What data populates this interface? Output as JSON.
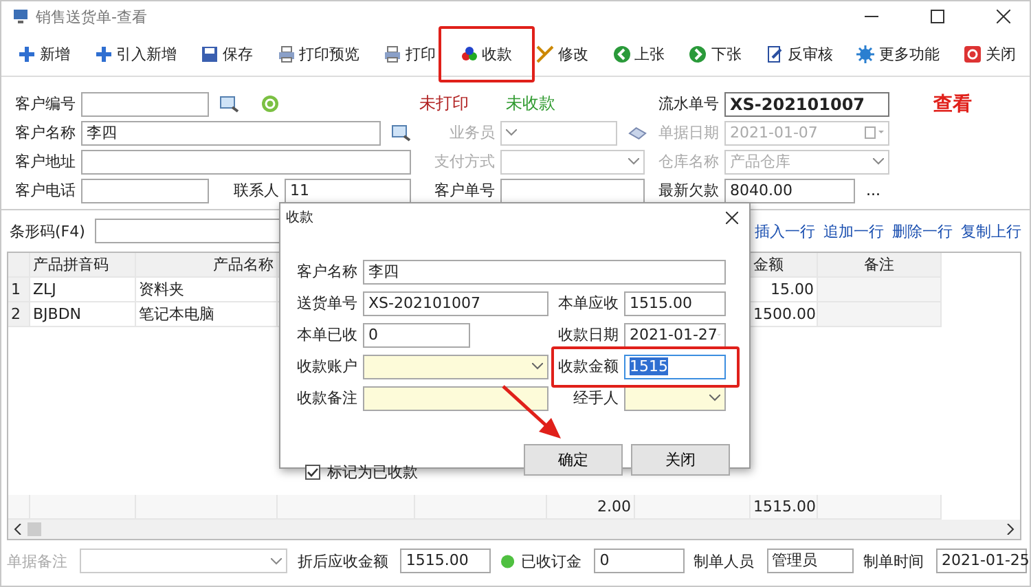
{
  "window": {
    "title": "销售送货单-查看"
  },
  "toolbar": [
    {
      "label": "新增",
      "highlighted": false
    },
    {
      "label": "引入新增",
      "highlighted": false
    },
    {
      "label": "保存",
      "highlighted": false
    },
    {
      "label": "打印预览",
      "highlighted": false
    },
    {
      "label": "打印",
      "highlighted": false
    },
    {
      "label": "收款",
      "highlighted": true
    },
    {
      "label": "修改",
      "highlighted": false
    },
    {
      "label": "上张",
      "highlighted": false
    },
    {
      "label": "下张",
      "highlighted": false
    },
    {
      "label": "反审核",
      "highlighted": false
    },
    {
      "label": "更多功能",
      "highlighted": false
    },
    {
      "label": "关闭",
      "highlighted": false
    }
  ],
  "form": {
    "print_status": "未打印",
    "payment_status": "未收款",
    "mode": "查看",
    "customer_code": {
      "label": "客户编号",
      "disabled": false
    },
    "serial_no": {
      "label": "流水单号",
      "value": "XS-202101007",
      "disabled": false
    },
    "customer_name": {
      "label": "客户名称",
      "value": "李四",
      "disabled": false
    },
    "salesperson": {
      "label": "业务员",
      "disabled": true
    },
    "doc_date": {
      "label": "单据日期",
      "value": "2021-01-07",
      "disabled": true
    },
    "address": {
      "label": "客户地址",
      "disabled": false
    },
    "payment_method": {
      "label": "支付方式",
      "disabled": true
    },
    "warehouse": {
      "label": "仓库名称",
      "value": "产品仓库",
      "disabled": true
    },
    "phone": {
      "label": "客户电话",
      "disabled": false
    },
    "contact": {
      "label": "联系人",
      "value": "11",
      "disabled": false
    },
    "customer_order": {
      "label": "客户单号",
      "disabled": false
    },
    "latest_debt": {
      "label": "最新欠款",
      "value": "8040.00",
      "disabled": false
    },
    "more": "..."
  },
  "barcode": {
    "label": "条形码(F4)"
  },
  "row_actions": [
    "插入一行",
    "追加一行",
    "删除一行",
    "复制上行"
  ],
  "table": {
    "columns": [
      "产品拼音码",
      "产品名称",
      "金额",
      "备注"
    ],
    "rows": [
      {
        "no": "1",
        "code": "ZLJ",
        "name": "资料夹",
        "amount": "15.00"
      },
      {
        "no": "2",
        "code": "BJBDN",
        "name": "笔记本电脑",
        "amount": "1500.00"
      }
    ],
    "totals": {
      "quantity": "2.00",
      "amount": "1515.00"
    }
  },
  "footer": {
    "remark": {
      "label": "单据备注",
      "disabled": true
    },
    "discounted": {
      "label": "折后应收金额",
      "value": "1515.00"
    },
    "deposit": {
      "label": "已收订金",
      "value": "0"
    },
    "creator": {
      "label": "制单人员",
      "value": "管理员"
    },
    "created": {
      "label": "制单时间",
      "value": "2021-01-25"
    }
  },
  "dialog": {
    "title": "收款",
    "customer_name": {
      "label": "客户名称",
      "value": "李四"
    },
    "delivery_no": {
      "label": "送货单号",
      "value": "XS-202101007"
    },
    "receivable": {
      "label": "本单应收",
      "value": "1515.00"
    },
    "received": {
      "label": "本单已收",
      "value": "0"
    },
    "receipt_date": {
      "label": "收款日期",
      "value": "2021-01-27"
    },
    "account": {
      "label": "收款账户"
    },
    "amount": {
      "label": "收款金额",
      "value": "1515",
      "highlighted": true
    },
    "note": {
      "label": "收款备注"
    },
    "handler": {
      "label": "经手人"
    },
    "mark_paid": {
      "label": "标记为已收款",
      "checked": true
    },
    "buttons": [
      "确定",
      "关闭"
    ]
  }
}
